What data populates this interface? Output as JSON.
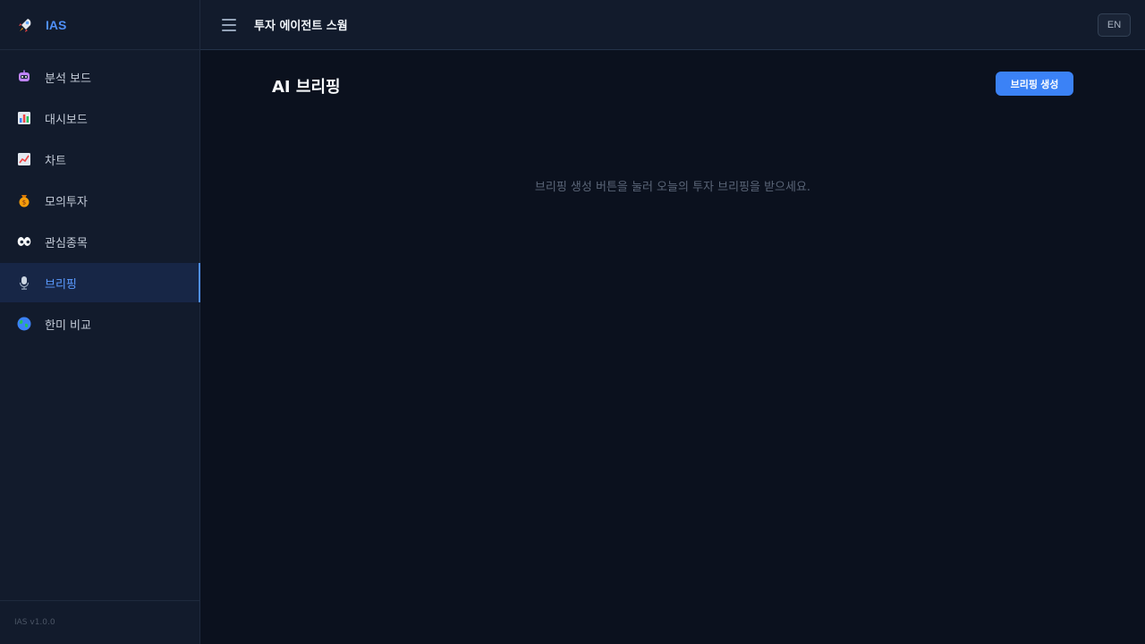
{
  "brand": {
    "name": "IAS",
    "icon": "rocket-icon"
  },
  "topbar": {
    "title": "투자 에이전트 스웜",
    "lang_button": "EN",
    "menu_icon": "hamburger-icon"
  },
  "sidebar": {
    "items": [
      {
        "label": "분석 보드",
        "icon": "robot-icon",
        "active": false
      },
      {
        "label": "대시보드",
        "icon": "bar-chart-icon",
        "active": false
      },
      {
        "label": "차트",
        "icon": "trend-up-icon",
        "active": false
      },
      {
        "label": "모의투자",
        "icon": "money-bag-icon",
        "active": false
      },
      {
        "label": "관심종목",
        "icon": "eyes-icon",
        "active": false
      },
      {
        "label": "브리핑",
        "icon": "microphone-icon",
        "active": true
      },
      {
        "label": "한미 비교",
        "icon": "globe-icon",
        "active": false
      }
    ],
    "version": "IAS v1.0.0"
  },
  "main": {
    "title": "AI 브리핑",
    "generate_button": "브리핑 생성",
    "empty_message": "브리핑 생성 버튼을 눌러 오늘의 투자 브리핑을 받으세요."
  },
  "colors": {
    "accent": "#3b82f6",
    "active_text": "#5b9bff",
    "background": "#0b111e",
    "sidebar": "#121b2c"
  }
}
